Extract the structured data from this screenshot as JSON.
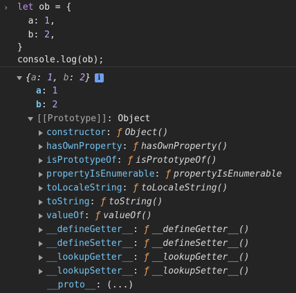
{
  "input": {
    "prompt_symbol": "›",
    "lines": [
      [
        "let",
        " ob = {"
      ],
      [
        "  ",
        "a",
        ": ",
        "1",
        ","
      ],
      [
        "  ",
        "b",
        ": ",
        "2",
        ","
      ],
      [
        "}",
        ""
      ],
      [
        "console.log(ob);"
      ]
    ]
  },
  "output": {
    "summary": {
      "open": "{",
      "a_key": "a",
      "sep1": ": ",
      "a_val": "1",
      "comma": ", ",
      "b_key": "b",
      "sep2": ": ",
      "b_val": "2",
      "close": "}",
      "info_icon": "info-icon",
      "info_glyph": "i"
    },
    "own_props": [
      {
        "key": "a",
        "value": "1"
      },
      {
        "key": "b",
        "value": "2"
      }
    ],
    "prototype": {
      "label": "[[Prototype]]",
      "sep": ": ",
      "value": "Object"
    },
    "proto_items": [
      {
        "key": "constructor",
        "sep": ": ",
        "f": "ƒ",
        "fn": "Object()"
      },
      {
        "key": "hasOwnProperty",
        "sep": ": ",
        "f": "ƒ",
        "fn": "hasOwnProperty()"
      },
      {
        "key": "isPrototypeOf",
        "sep": ": ",
        "f": "ƒ",
        "fn": "isPrototypeOf()"
      },
      {
        "key": "propertyIsEnumerable",
        "sep": ": ",
        "f": "ƒ",
        "fn": "propertyIsEnumerable"
      },
      {
        "key": "toLocaleString",
        "sep": ": ",
        "f": "ƒ",
        "fn": "toLocaleString()"
      },
      {
        "key": "toString",
        "sep": ": ",
        "f": "ƒ",
        "fn": "toString()"
      },
      {
        "key": "valueOf",
        "sep": ": ",
        "f": "ƒ",
        "fn": "valueOf()"
      },
      {
        "key": "__defineGetter__",
        "sep": ": ",
        "f": "ƒ",
        "fn": "__defineGetter__()"
      },
      {
        "key": "__defineSetter__",
        "sep": ": ",
        "f": "ƒ",
        "fn": "__defineSetter__()"
      },
      {
        "key": "__lookupGetter__",
        "sep": ": ",
        "f": "ƒ",
        "fn": "__lookupGetter__()"
      },
      {
        "key": "__lookupSetter__",
        "sep": ": ",
        "f": "ƒ",
        "fn": "__lookupSetter__()"
      }
    ],
    "proto_getter": {
      "key": "__proto__",
      "sep": ": ",
      "value": "(...)"
    }
  }
}
